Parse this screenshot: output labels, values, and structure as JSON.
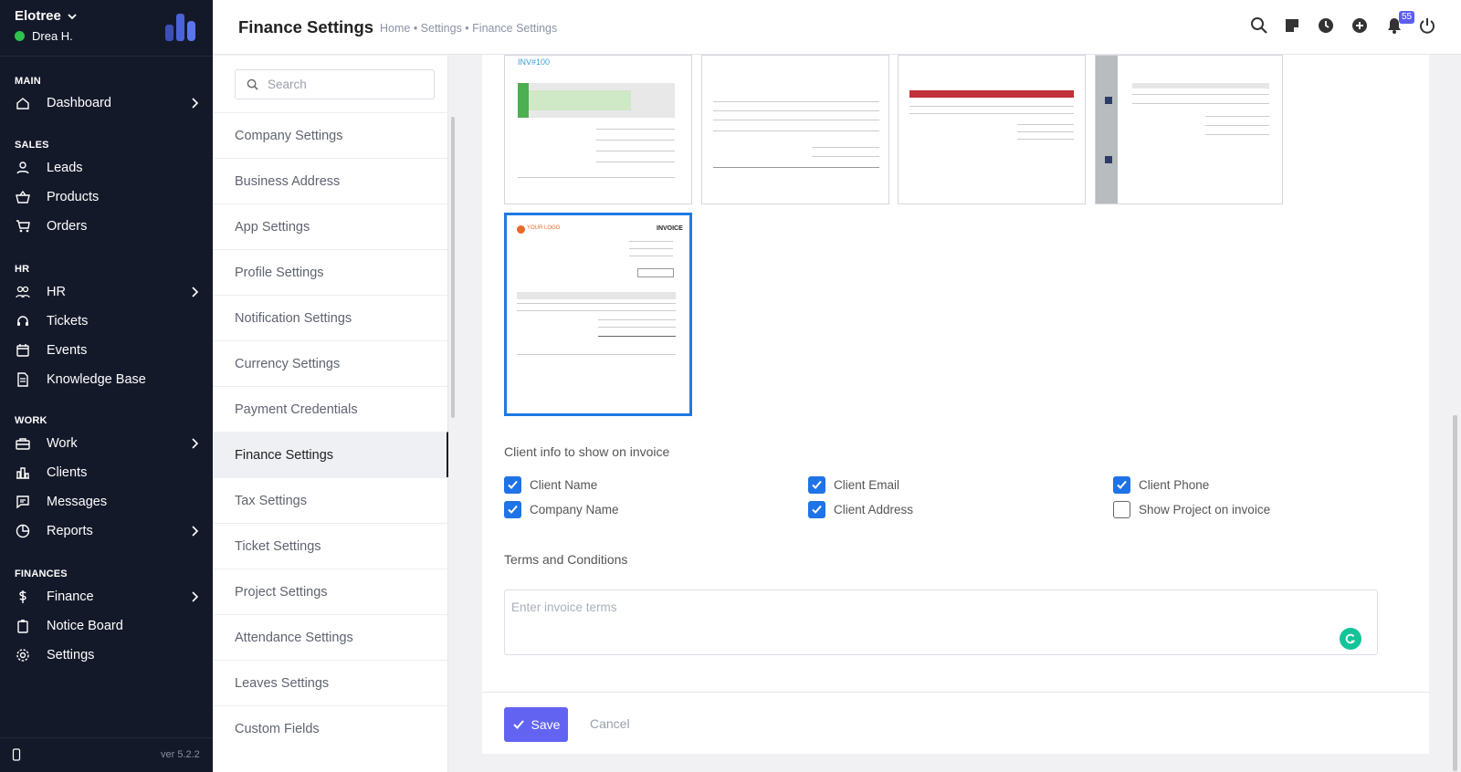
{
  "app": {
    "name": "Elotree",
    "user": "Drea H.",
    "version": "ver 5.2.2"
  },
  "sidebar": {
    "sections": [
      {
        "title": "MAIN",
        "items": [
          {
            "label": "Dashboard",
            "icon": "home-icon",
            "chevron": true
          }
        ]
      },
      {
        "title": "SALES",
        "items": [
          {
            "label": "Leads",
            "icon": "user-icon"
          },
          {
            "label": "Products",
            "icon": "basket-icon"
          },
          {
            "label": "Orders",
            "icon": "cart-icon"
          }
        ]
      },
      {
        "title": "HR",
        "items": [
          {
            "label": "HR",
            "icon": "people-icon",
            "chevron": true
          },
          {
            "label": "Tickets",
            "icon": "headset-icon"
          },
          {
            "label": "Events",
            "icon": "calendar-icon"
          },
          {
            "label": "Knowledge Base",
            "icon": "document-icon"
          }
        ]
      },
      {
        "title": "WORK",
        "items": [
          {
            "label": "Work",
            "icon": "briefcase-icon",
            "chevron": true
          },
          {
            "label": "Clients",
            "icon": "building-icon"
          },
          {
            "label": "Messages",
            "icon": "message-icon"
          },
          {
            "label": "Reports",
            "icon": "pie-chart-icon",
            "chevron": true
          }
        ]
      },
      {
        "title": "FINANCES",
        "items": [
          {
            "label": "Finance",
            "icon": "dollar-icon",
            "chevron": true
          },
          {
            "label": "Notice Board",
            "icon": "clipboard-icon"
          },
          {
            "label": "Settings",
            "icon": "gear-icon"
          }
        ]
      }
    ]
  },
  "header": {
    "title": "Finance Settings",
    "breadcrumb": "Home • Settings • Finance Settings",
    "notification_count": "55"
  },
  "settings_menu": {
    "search_placeholder": "Search",
    "items": [
      "Company Settings",
      "Business Address",
      "App Settings",
      "Profile Settings",
      "Notification Settings",
      "Currency Settings",
      "Payment Credentials",
      "Finance Settings",
      "Tax Settings",
      "Ticket Settings",
      "Project Settings",
      "Attendance Settings",
      "Leaves Settings",
      "Custom Fields"
    ],
    "active": "Finance Settings"
  },
  "templates": {
    "selected": 5,
    "count": 5
  },
  "client_info": {
    "title": "Client info to show on invoice",
    "options": [
      {
        "label": "Client Name",
        "checked": true
      },
      {
        "label": "Client Email",
        "checked": true
      },
      {
        "label": "Client Phone",
        "checked": true
      },
      {
        "label": "Company Name",
        "checked": true
      },
      {
        "label": "Client Address",
        "checked": true
      },
      {
        "label": "Show Project on invoice",
        "checked": false
      }
    ]
  },
  "terms": {
    "title": "Terms and Conditions",
    "placeholder": "Enter invoice terms"
  },
  "actions": {
    "save": "Save",
    "cancel": "Cancel"
  },
  "colors": {
    "sidebar_bg": "#14192a",
    "accent": "#6264f1",
    "checkbox": "#1f73e6",
    "selected_border": "#1f7ae0"
  }
}
